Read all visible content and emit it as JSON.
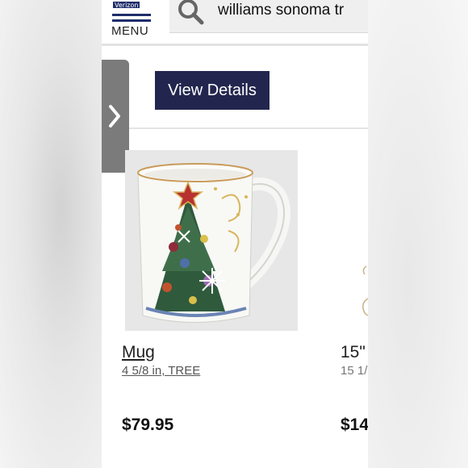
{
  "status": {
    "carrier": "Verizon"
  },
  "header": {
    "menu_label": "MENU",
    "search_value": "williams sonoma tr"
  },
  "actions": {
    "view_details_label": "View Details"
  },
  "products": [
    {
      "name": "Mug",
      "description": "4 5/8 in, TREE",
      "price": "$79.95",
      "image": "christmas-tree-mug"
    },
    {
      "name": "15\"",
      "description": "15 1/",
      "price": "$14"
    }
  ],
  "colors": {
    "brand_navy": "#22264e",
    "header_navy": "#1f2d6b",
    "side_tab": "#7b7b7b"
  },
  "icons": [
    "search-icon",
    "hamburger-icon",
    "chevron-right-icon"
  ]
}
